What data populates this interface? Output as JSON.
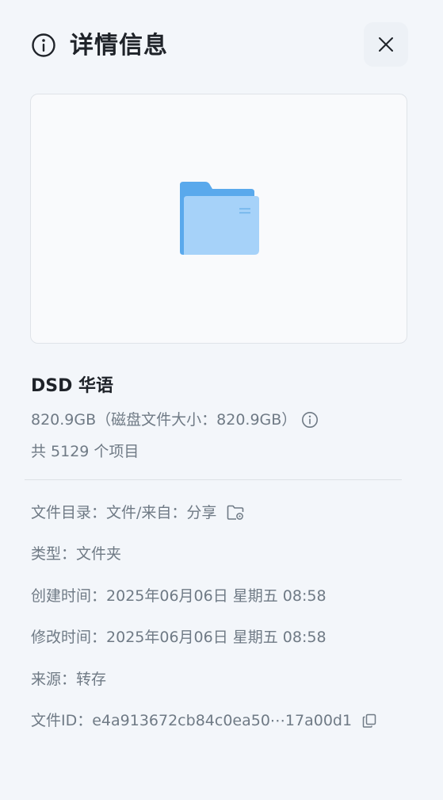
{
  "header": {
    "title": "详情信息",
    "info_icon": "info-circle-icon",
    "close_icon": "close-icon"
  },
  "preview": {
    "icon": "folder-icon",
    "colors": {
      "folder_back": "#5aa9ec",
      "folder_front": "#a6d2f9"
    }
  },
  "item": {
    "name": "DSD 华语",
    "size": "820.9GB（磁盘文件大小：820.9GB）",
    "count": "共 5129 个项目"
  },
  "details": {
    "directory": {
      "label": "文件目录：",
      "value": "文件/来自：分享",
      "icon": "folder-share-icon"
    },
    "type": {
      "label": "类型：",
      "value": "文件夹"
    },
    "created": {
      "label": "创建时间：",
      "value": "2025年06月06日 星期五 08:58"
    },
    "modified": {
      "label": "修改时间：",
      "value": "2025年06月06日 星期五 08:58"
    },
    "source": {
      "label": "来源：",
      "value": "转存"
    },
    "file_id": {
      "label": "文件ID：",
      "value": "e4a913672cb84c0ea50⋯17a00d1",
      "icon": "copy-icon"
    }
  }
}
